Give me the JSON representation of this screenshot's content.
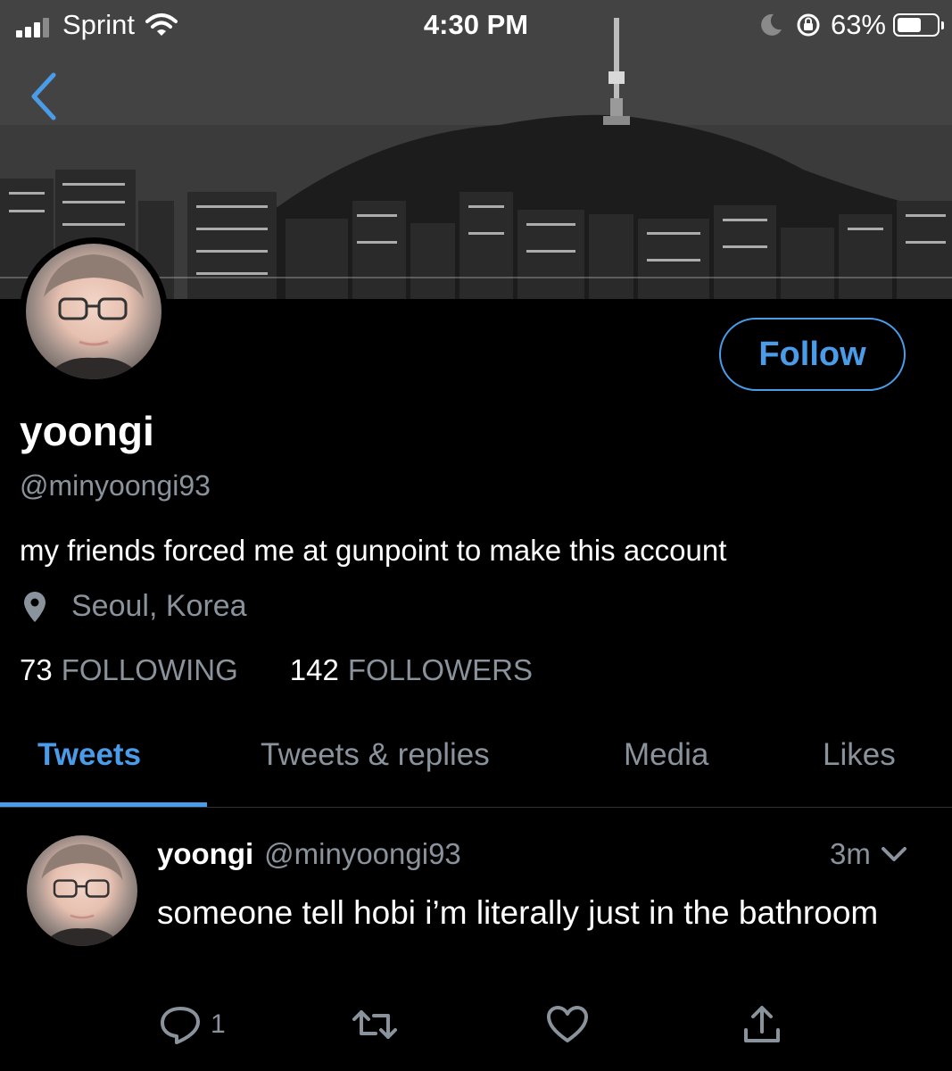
{
  "status_bar": {
    "carrier": "Sprint",
    "time": "4:30 PM",
    "battery_percent": "63%",
    "battery_level": 0.63,
    "signal_bars": 3,
    "icons": [
      "signal-icon",
      "wifi-icon",
      "moon-icon",
      "orientation-lock-icon",
      "battery-icon"
    ]
  },
  "header": {
    "back_icon": "chevron-left-icon"
  },
  "profile": {
    "display_name": "yoongi",
    "handle": "@minyoongi93",
    "bio": "my friends forced me at gunpoint to make this account",
    "location": "Seoul, Korea",
    "location_icon": "location-pin-icon",
    "follow_label": "Follow",
    "following_count": "73",
    "following_label": "FOLLOWING",
    "followers_count": "142",
    "followers_label": "FOLLOWERS"
  },
  "tabs": [
    {
      "label": "Tweets",
      "active": true
    },
    {
      "label": "Tweets & replies",
      "active": false
    },
    {
      "label": "Media",
      "active": false
    },
    {
      "label": "Likes",
      "active": false
    }
  ],
  "tweet": {
    "name": "yoongi",
    "handle": "@minyoongi93",
    "time": "3m",
    "text": "someone tell hobi i’m literally just in the bathroom",
    "reply_count": "1",
    "action_icons": [
      "reply-icon",
      "retweet-icon",
      "like-icon",
      "share-icon"
    ]
  },
  "colors": {
    "accent": "#4a9ce8",
    "secondary_text": "#8a939c",
    "background": "#000000"
  }
}
